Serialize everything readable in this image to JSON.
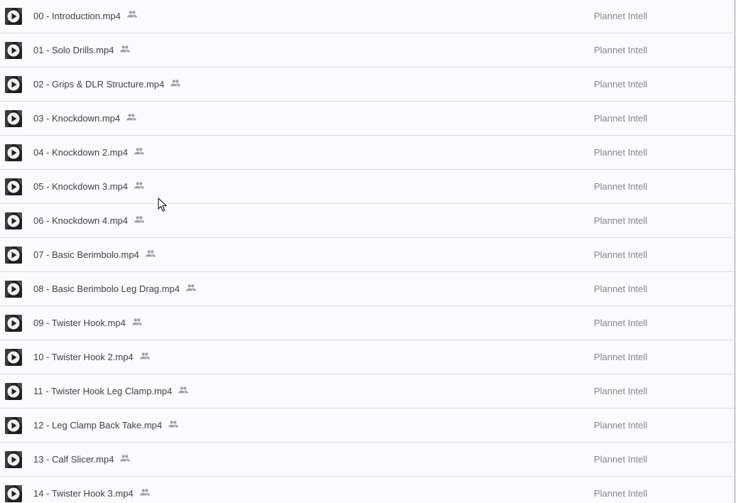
{
  "files": [
    {
      "name": "00 - Introduction.mp4",
      "owner": "Plannet Intell",
      "icon": "video-thumbnail",
      "shared_icon": "people-icon"
    },
    {
      "name": "01 - Solo Drills.mp4",
      "owner": "Plannet Intell",
      "icon": "video-thumbnail",
      "shared_icon": "people-icon"
    },
    {
      "name": "02 - Grips & DLR Structure.mp4",
      "owner": "Plannet Intell",
      "icon": "video-thumbnail",
      "shared_icon": "people-icon"
    },
    {
      "name": "03 - Knockdown.mp4",
      "owner": "Plannet Intell",
      "icon": "video-thumbnail",
      "shared_icon": "people-icon"
    },
    {
      "name": "04 - Knockdown 2.mp4",
      "owner": "Plannet Intell",
      "icon": "video-thumbnail",
      "shared_icon": "people-icon"
    },
    {
      "name": "05 - Knockdown 3.mp4",
      "owner": "Plannet Intell",
      "icon": "video-thumbnail",
      "shared_icon": "people-icon"
    },
    {
      "name": "06 - Knockdown 4.mp4",
      "owner": "Plannet Intell",
      "icon": "video-thumbnail",
      "shared_icon": "people-icon"
    },
    {
      "name": "07 - Basic Berimbolo.mp4",
      "owner": "Plannet Intell",
      "icon": "video-thumbnail",
      "shared_icon": "people-icon"
    },
    {
      "name": "08 - Basic Berimbolo Leg Drag.mp4",
      "owner": "Plannet Intell",
      "icon": "video-thumbnail",
      "shared_icon": "people-icon"
    },
    {
      "name": "09 - Twister Hook.mp4",
      "owner": "Plannet Intell",
      "icon": "video-thumbnail",
      "shared_icon": "people-icon"
    },
    {
      "name": "10 - Twister Hook 2.mp4",
      "owner": "Plannet Intell",
      "icon": "video-thumbnail",
      "shared_icon": "people-icon"
    },
    {
      "name": "11 - Twister Hook Leg Clamp.mp4",
      "owner": "Plannet Intell",
      "icon": "video-thumbnail",
      "shared_icon": "people-icon"
    },
    {
      "name": "12 - Leg Clamp Back Take.mp4",
      "owner": "Plannet Intell",
      "icon": "video-thumbnail",
      "shared_icon": "people-icon"
    },
    {
      "name": "13 - Calf Slicer.mp4",
      "owner": "Plannet Intell",
      "icon": "video-thumbnail",
      "shared_icon": "people-icon"
    },
    {
      "name": "14 - Twister Hook 3.mp4",
      "owner": "Plannet Intell",
      "icon": "video-thumbnail",
      "shared_icon": "people-icon"
    }
  ],
  "colors": {
    "row_background": "#fbfbfe",
    "row_divider": "#dadce0",
    "filename_text": "#3c4043",
    "owner_text": "#80868b",
    "shared_icon": "#9aa0a6"
  }
}
